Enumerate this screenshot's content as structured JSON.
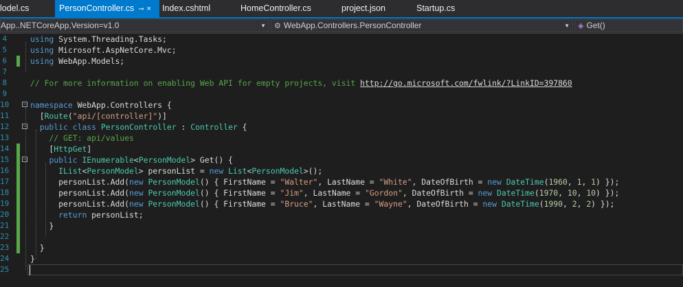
{
  "tabs": [
    {
      "label": "lodel.cs",
      "active": false
    },
    {
      "label": "PersonController.cs",
      "active": true,
      "pin": "⊸",
      "close": "×"
    },
    {
      "label": "Index.cshtml",
      "active": false
    },
    {
      "label": "HomeController.cs",
      "active": false
    },
    {
      "label": "project.json",
      "active": false
    },
    {
      "label": "Startup.cs",
      "active": false
    }
  ],
  "navbar": {
    "project": "App..NETCoreApp,Version=v1.0",
    "type_icon": "class-icon",
    "type": "WebApp.Controllers.PersonController",
    "member_icon": "method-icon",
    "member": "Get()"
  },
  "editor": {
    "line_numbers": [
      "4",
      "5",
      "6",
      "7",
      "8",
      "9",
      "10",
      "11",
      "12",
      "13",
      "14",
      "15",
      "16",
      "17",
      "18",
      "19",
      "20",
      "21",
      "22",
      "23",
      "24",
      "25"
    ],
    "lines": [
      [
        {
          "t": "using ",
          "c": "kw"
        },
        {
          "t": "System.Threading.Tasks;",
          "c": "pl"
        }
      ],
      [
        {
          "t": "using ",
          "c": "kw"
        },
        {
          "t": "Microsoft.AspNetCore.Mvc;",
          "c": "pl"
        }
      ],
      [
        {
          "t": "using ",
          "c": "kw"
        },
        {
          "t": "WebApp.Models;",
          "c": "pl"
        }
      ],
      [],
      [
        {
          "t": "// For more information on enabling Web API for empty projects, visit ",
          "c": "cm"
        },
        {
          "t": "http://go.microsoft.com/fwlink/?LinkID=397860",
          "c": "ur"
        }
      ],
      [],
      [
        {
          "t": "namespace ",
          "c": "kw"
        },
        {
          "t": "WebApp.Controllers {",
          "c": "pl"
        }
      ],
      [
        {
          "t": "  [",
          "c": "pl"
        },
        {
          "t": "Route",
          "c": "ty"
        },
        {
          "t": "(",
          "c": "pl"
        },
        {
          "t": "\"api/[controller]\"",
          "c": "st"
        },
        {
          "t": ")]",
          "c": "pl"
        }
      ],
      [
        {
          "t": "  ",
          "c": "pl"
        },
        {
          "t": "public ",
          "c": "kw"
        },
        {
          "t": "class ",
          "c": "kw"
        },
        {
          "t": "PersonController",
          "c": "ty"
        },
        {
          "t": " : ",
          "c": "pl"
        },
        {
          "t": "Controller",
          "c": "ty"
        },
        {
          "t": " {",
          "c": "pl"
        }
      ],
      [
        {
          "t": "    // GET: api/values",
          "c": "cm"
        }
      ],
      [
        {
          "t": "    [",
          "c": "pl"
        },
        {
          "t": "HttpGet",
          "c": "ty"
        },
        {
          "t": "]",
          "c": "pl"
        }
      ],
      [
        {
          "t": "    ",
          "c": "pl"
        },
        {
          "t": "public ",
          "c": "kw"
        },
        {
          "t": "IEnumerable",
          "c": "ty"
        },
        {
          "t": "<",
          "c": "pl"
        },
        {
          "t": "PersonModel",
          "c": "ty"
        },
        {
          "t": "> Get() {",
          "c": "pl"
        }
      ],
      [
        {
          "t": "      ",
          "c": "pl"
        },
        {
          "t": "IList",
          "c": "ty"
        },
        {
          "t": "<",
          "c": "pl"
        },
        {
          "t": "PersonModel",
          "c": "ty"
        },
        {
          "t": "> personList = ",
          "c": "pl"
        },
        {
          "t": "new ",
          "c": "kw"
        },
        {
          "t": "List",
          "c": "ty"
        },
        {
          "t": "<",
          "c": "pl"
        },
        {
          "t": "PersonModel",
          "c": "ty"
        },
        {
          "t": ">();",
          "c": "pl"
        }
      ],
      [
        {
          "t": "      personList.Add(",
          "c": "pl"
        },
        {
          "t": "new ",
          "c": "kw"
        },
        {
          "t": "PersonModel",
          "c": "ty"
        },
        {
          "t": "() { FirstName = ",
          "c": "pl"
        },
        {
          "t": "\"Walter\"",
          "c": "st"
        },
        {
          "t": ", LastName = ",
          "c": "pl"
        },
        {
          "t": "\"White\"",
          "c": "st"
        },
        {
          "t": ", DateOfBirth = ",
          "c": "pl"
        },
        {
          "t": "new ",
          "c": "kw"
        },
        {
          "t": "DateTime",
          "c": "ty"
        },
        {
          "t": "(",
          "c": "pl"
        },
        {
          "t": "1960",
          "c": "nu"
        },
        {
          "t": ", ",
          "c": "pl"
        },
        {
          "t": "1",
          "c": "nu"
        },
        {
          "t": ", ",
          "c": "pl"
        },
        {
          "t": "1",
          "c": "nu"
        },
        {
          "t": ") });",
          "c": "pl"
        }
      ],
      [
        {
          "t": "      personList.Add(",
          "c": "pl"
        },
        {
          "t": "new ",
          "c": "kw"
        },
        {
          "t": "PersonModel",
          "c": "ty"
        },
        {
          "t": "() { FirstName = ",
          "c": "pl"
        },
        {
          "t": "\"Jim\"",
          "c": "st"
        },
        {
          "t": ", LastName = ",
          "c": "pl"
        },
        {
          "t": "\"Gordon\"",
          "c": "st"
        },
        {
          "t": ", DateOfBirth = ",
          "c": "pl"
        },
        {
          "t": "new ",
          "c": "kw"
        },
        {
          "t": "DateTime",
          "c": "ty"
        },
        {
          "t": "(",
          "c": "pl"
        },
        {
          "t": "1970",
          "c": "nu"
        },
        {
          "t": ", ",
          "c": "pl"
        },
        {
          "t": "10",
          "c": "nu"
        },
        {
          "t": ", ",
          "c": "pl"
        },
        {
          "t": "10",
          "c": "nu"
        },
        {
          "t": ") });",
          "c": "pl"
        }
      ],
      [
        {
          "t": "      personList.Add(",
          "c": "pl"
        },
        {
          "t": "new ",
          "c": "kw"
        },
        {
          "t": "PersonModel",
          "c": "ty"
        },
        {
          "t": "() { FirstName = ",
          "c": "pl"
        },
        {
          "t": "\"Bruce\"",
          "c": "st"
        },
        {
          "t": ", LastName = ",
          "c": "pl"
        },
        {
          "t": "\"Wayne\"",
          "c": "st"
        },
        {
          "t": ", DateOfBirth = ",
          "c": "pl"
        },
        {
          "t": "new ",
          "c": "kw"
        },
        {
          "t": "DateTime",
          "c": "ty"
        },
        {
          "t": "(",
          "c": "pl"
        },
        {
          "t": "1990",
          "c": "nu"
        },
        {
          "t": ", ",
          "c": "pl"
        },
        {
          "t": "2",
          "c": "nu"
        },
        {
          "t": ", ",
          "c": "pl"
        },
        {
          "t": "2",
          "c": "nu"
        },
        {
          "t": ") });",
          "c": "pl"
        }
      ],
      [
        {
          "t": "      ",
          "c": "pl"
        },
        {
          "t": "return ",
          "c": "kw"
        },
        {
          "t": "personList;",
          "c": "pl"
        }
      ],
      [
        {
          "t": "    }",
          "c": "pl"
        }
      ],
      [],
      [
        {
          "t": "  }",
          "c": "pl"
        }
      ],
      [
        {
          "t": "}",
          "c": "pl"
        }
      ],
      []
    ],
    "fold_markers": {
      "6": "−",
      "8": "−",
      "11": "−"
    },
    "changed_lines": [
      2,
      10,
      11,
      12,
      13,
      14,
      15,
      16,
      17,
      18,
      19
    ]
  },
  "colors": {
    "accent": "#007acc",
    "keyword": "#569cd6",
    "type": "#4ec9b0",
    "string": "#d69d85",
    "comment": "#57a64a",
    "number": "#b5cea8",
    "line_number": "#2b91af",
    "change_bar": "#57a64a"
  }
}
